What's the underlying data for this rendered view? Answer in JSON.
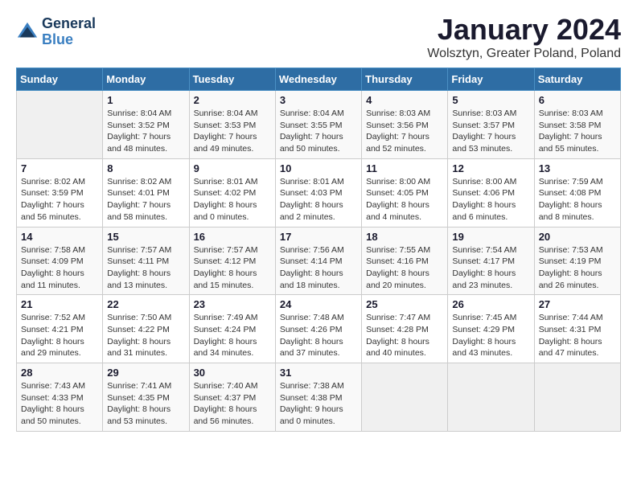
{
  "logo": {
    "general": "General",
    "blue": "Blue"
  },
  "title": "January 2024",
  "location": "Wolsztyn, Greater Poland, Poland",
  "days_of_week": [
    "Sunday",
    "Monday",
    "Tuesday",
    "Wednesday",
    "Thursday",
    "Friday",
    "Saturday"
  ],
  "weeks": [
    [
      {
        "day": "",
        "content": ""
      },
      {
        "day": "1",
        "sunrise": "Sunrise: 8:04 AM",
        "sunset": "Sunset: 3:52 PM",
        "daylight": "Daylight: 7 hours and 48 minutes."
      },
      {
        "day": "2",
        "sunrise": "Sunrise: 8:04 AM",
        "sunset": "Sunset: 3:53 PM",
        "daylight": "Daylight: 7 hours and 49 minutes."
      },
      {
        "day": "3",
        "sunrise": "Sunrise: 8:04 AM",
        "sunset": "Sunset: 3:55 PM",
        "daylight": "Daylight: 7 hours and 50 minutes."
      },
      {
        "day": "4",
        "sunrise": "Sunrise: 8:03 AM",
        "sunset": "Sunset: 3:56 PM",
        "daylight": "Daylight: 7 hours and 52 minutes."
      },
      {
        "day": "5",
        "sunrise": "Sunrise: 8:03 AM",
        "sunset": "Sunset: 3:57 PM",
        "daylight": "Daylight: 7 hours and 53 minutes."
      },
      {
        "day": "6",
        "sunrise": "Sunrise: 8:03 AM",
        "sunset": "Sunset: 3:58 PM",
        "daylight": "Daylight: 7 hours and 55 minutes."
      }
    ],
    [
      {
        "day": "7",
        "sunrise": "Sunrise: 8:02 AM",
        "sunset": "Sunset: 3:59 PM",
        "daylight": "Daylight: 7 hours and 56 minutes."
      },
      {
        "day": "8",
        "sunrise": "Sunrise: 8:02 AM",
        "sunset": "Sunset: 4:01 PM",
        "daylight": "Daylight: 7 hours and 58 minutes."
      },
      {
        "day": "9",
        "sunrise": "Sunrise: 8:01 AM",
        "sunset": "Sunset: 4:02 PM",
        "daylight": "Daylight: 8 hours and 0 minutes."
      },
      {
        "day": "10",
        "sunrise": "Sunrise: 8:01 AM",
        "sunset": "Sunset: 4:03 PM",
        "daylight": "Daylight: 8 hours and 2 minutes."
      },
      {
        "day": "11",
        "sunrise": "Sunrise: 8:00 AM",
        "sunset": "Sunset: 4:05 PM",
        "daylight": "Daylight: 8 hours and 4 minutes."
      },
      {
        "day": "12",
        "sunrise": "Sunrise: 8:00 AM",
        "sunset": "Sunset: 4:06 PM",
        "daylight": "Daylight: 8 hours and 6 minutes."
      },
      {
        "day": "13",
        "sunrise": "Sunrise: 7:59 AM",
        "sunset": "Sunset: 4:08 PM",
        "daylight": "Daylight: 8 hours and 8 minutes."
      }
    ],
    [
      {
        "day": "14",
        "sunrise": "Sunrise: 7:58 AM",
        "sunset": "Sunset: 4:09 PM",
        "daylight": "Daylight: 8 hours and 11 minutes."
      },
      {
        "day": "15",
        "sunrise": "Sunrise: 7:57 AM",
        "sunset": "Sunset: 4:11 PM",
        "daylight": "Daylight: 8 hours and 13 minutes."
      },
      {
        "day": "16",
        "sunrise": "Sunrise: 7:57 AM",
        "sunset": "Sunset: 4:12 PM",
        "daylight": "Daylight: 8 hours and 15 minutes."
      },
      {
        "day": "17",
        "sunrise": "Sunrise: 7:56 AM",
        "sunset": "Sunset: 4:14 PM",
        "daylight": "Daylight: 8 hours and 18 minutes."
      },
      {
        "day": "18",
        "sunrise": "Sunrise: 7:55 AM",
        "sunset": "Sunset: 4:16 PM",
        "daylight": "Daylight: 8 hours and 20 minutes."
      },
      {
        "day": "19",
        "sunrise": "Sunrise: 7:54 AM",
        "sunset": "Sunset: 4:17 PM",
        "daylight": "Daylight: 8 hours and 23 minutes."
      },
      {
        "day": "20",
        "sunrise": "Sunrise: 7:53 AM",
        "sunset": "Sunset: 4:19 PM",
        "daylight": "Daylight: 8 hours and 26 minutes."
      }
    ],
    [
      {
        "day": "21",
        "sunrise": "Sunrise: 7:52 AM",
        "sunset": "Sunset: 4:21 PM",
        "daylight": "Daylight: 8 hours and 29 minutes."
      },
      {
        "day": "22",
        "sunrise": "Sunrise: 7:50 AM",
        "sunset": "Sunset: 4:22 PM",
        "daylight": "Daylight: 8 hours and 31 minutes."
      },
      {
        "day": "23",
        "sunrise": "Sunrise: 7:49 AM",
        "sunset": "Sunset: 4:24 PM",
        "daylight": "Daylight: 8 hours and 34 minutes."
      },
      {
        "day": "24",
        "sunrise": "Sunrise: 7:48 AM",
        "sunset": "Sunset: 4:26 PM",
        "daylight": "Daylight: 8 hours and 37 minutes."
      },
      {
        "day": "25",
        "sunrise": "Sunrise: 7:47 AM",
        "sunset": "Sunset: 4:28 PM",
        "daylight": "Daylight: 8 hours and 40 minutes."
      },
      {
        "day": "26",
        "sunrise": "Sunrise: 7:45 AM",
        "sunset": "Sunset: 4:29 PM",
        "daylight": "Daylight: 8 hours and 43 minutes."
      },
      {
        "day": "27",
        "sunrise": "Sunrise: 7:44 AM",
        "sunset": "Sunset: 4:31 PM",
        "daylight": "Daylight: 8 hours and 47 minutes."
      }
    ],
    [
      {
        "day": "28",
        "sunrise": "Sunrise: 7:43 AM",
        "sunset": "Sunset: 4:33 PM",
        "daylight": "Daylight: 8 hours and 50 minutes."
      },
      {
        "day": "29",
        "sunrise": "Sunrise: 7:41 AM",
        "sunset": "Sunset: 4:35 PM",
        "daylight": "Daylight: 8 hours and 53 minutes."
      },
      {
        "day": "30",
        "sunrise": "Sunrise: 7:40 AM",
        "sunset": "Sunset: 4:37 PM",
        "daylight": "Daylight: 8 hours and 56 minutes."
      },
      {
        "day": "31",
        "sunrise": "Sunrise: 7:38 AM",
        "sunset": "Sunset: 4:38 PM",
        "daylight": "Daylight: 9 hours and 0 minutes."
      },
      {
        "day": "",
        "content": ""
      },
      {
        "day": "",
        "content": ""
      },
      {
        "day": "",
        "content": ""
      }
    ]
  ]
}
